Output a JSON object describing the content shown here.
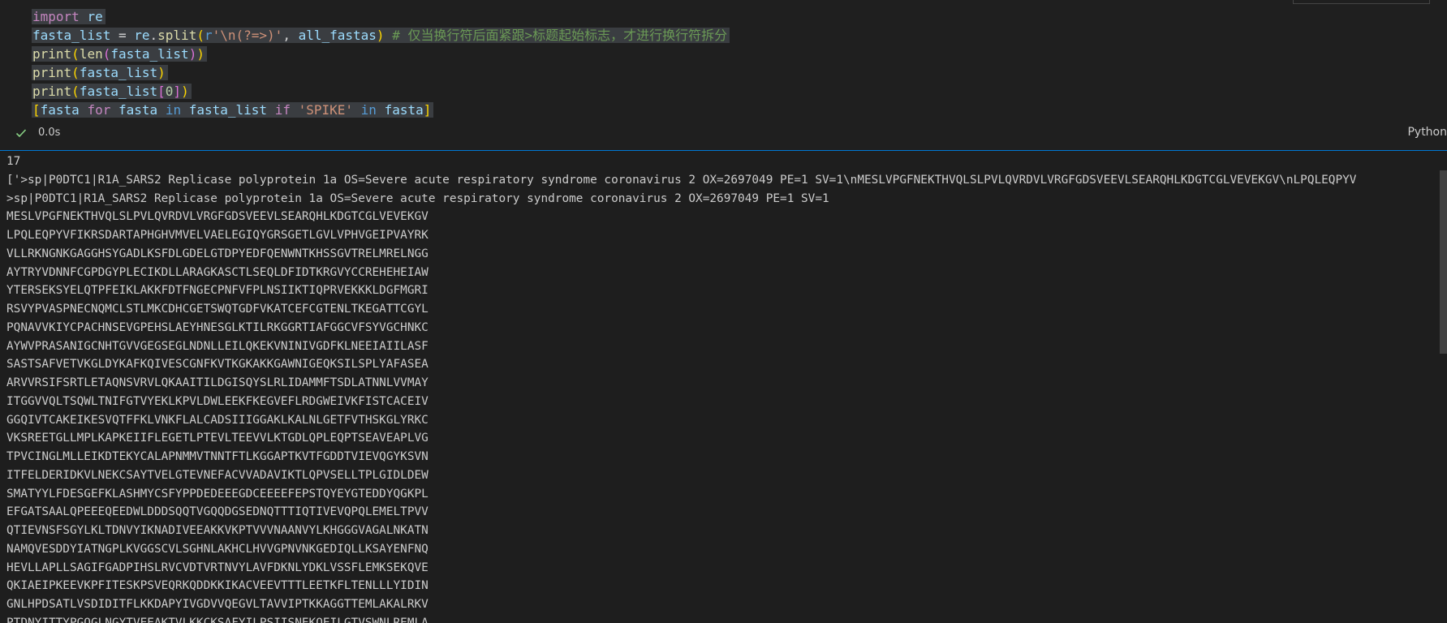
{
  "cell": {
    "code": {
      "line1": {
        "kw": "import",
        "mod": "re"
      },
      "line2": {
        "var": "fasta_list",
        "eq": "=",
        "obj": "re",
        "dot": ".",
        "fn": "split",
        "open": "(",
        "rprefix": "r",
        "pattern": "'\\n(?=>)'",
        "comma": ",",
        "arg": "all_fastas",
        "close": ")",
        "comment": "# 仅当换行符后面紧跟>标题起始标志，才进行换行符拆分"
      },
      "line3": {
        "fn1": "print",
        "o1": "(",
        "fn2": "len",
        "o2": "(",
        "arg": "fasta_list",
        "c2": ")",
        "c1": ")"
      },
      "line4": {
        "fn": "print",
        "open": "(",
        "arg": "fasta_list",
        "close": ")"
      },
      "line5": {
        "fn": "print",
        "open": "(",
        "arg": "fasta_list",
        "lb": "[",
        "idx": "0",
        "rb": "]",
        "close": ")"
      },
      "line6": {
        "lb": "[",
        "v1": "fasta",
        "for": "for",
        "v2": "fasta",
        "in1": "in",
        "v3": "fasta_list",
        "if": "if",
        "str": "'SPIKE'",
        "in2": "in",
        "v4": "fasta",
        "rb": "]"
      }
    },
    "exec_time": "0.0s",
    "language": "Python",
    "status_icon": "check-icon"
  },
  "output": {
    "lines": [
      "17",
      "['>sp|P0DTC1|R1A_SARS2 Replicase polyprotein 1a OS=Severe acute respiratory syndrome coronavirus 2 OX=2697049 PE=1 SV=1\\nMESLVPGFNEKTHVQLSLPVLQVRDVLVRGFGDSVEEVLSEARQHLKDGTCGLVEVEKGV\\nLPQLEQPYV",
      ">sp|P0DTC1|R1A_SARS2 Replicase polyprotein 1a OS=Severe acute respiratory syndrome coronavirus 2 OX=2697049 PE=1 SV=1",
      "MESLVPGFNEKTHVQLSLPVLQVRDVLVRGFGDSVEEVLSEARQHLKDGTCGLVEVEKGV",
      "LPQLEQPYVFIKRSDARTAPHGHVMVELVAELEGIQYGRSGETLGVLVPHVGEIPVAYRK",
      "VLLRKNGNKGAGGHSYGADLKSFDLGDELGTDPYEDFQENWNTKHSSGVTRELMRELNGG",
      "AYTRYVDNNFCGPDGYPLECIKDLLARAGKASCTLSEQLDFIDTKRGVYCCREHEHEIAW",
      "YTERSEKSYELQTPFEIKLAKKFDTFNGECPNFVFPLNSIIKTIQPRVEKKKLDGFMGRI",
      "RSVYPVASPNECNQMCLSTLMKCDHCGETSWQTGDFVKATCEFCGTENLTKEGATTCGYL",
      "PQNAVVKIYCPACHNSEVGPEHSLAEYHNESGLKTILRKGGRTIAFGGCVFSYVGCHNKC",
      "AYWVPRASANIGCNHTGVVGEGSEGLNDNLLEILQKEKVNINIVGDFKLNEEIAIILASF",
      "SASTSAFVETVKGLDYKAFKQIVESCGNFKVTKGKAKKGAWNIGEQKSILSPLYAFASEA",
      "ARVVRSIFSRTLETAQNSVRVLQKAAITILDGISQYSLRLIDAMMFTSDLATNNLVVMAY",
      "ITGGVVQLTSQWLTNIFGTVYEKLKPVLDWLEEKFKEGVEFLRDGWEIVKFISTCACEIV",
      "GGQIVTCAKEIKESVQTFFKLVNKFLALCADSIIIGGAKLKALNLGETFVTHSKGLYRKC",
      "VKSREETGLLMPLKAPKEIIFLEGETLPTEVLTEEVVLKTGDLQPLEQPTSEAVEAPLVG",
      "TPVCINGLMLLEIKDTEKYCALAPNMMVTNNTFTLKGGAPTKVTFGDDTVIEVQGYKSVN",
      "ITFELDERIDKVLNEKCSAYTVELGTEVNEFACVVADAVIKTLQPVSELLTPLGIDLDEW",
      "SMATYYLFDESGEFKLASHMYCSFYPPDEDEEEGDCEEEEFEPSTQYEYGTEDDYQGKPL",
      "EFGATSAALQPEEEQEEDWLDDDSQQTVGQQDGSEDNQTTTIQTIVEVQPQLEMELTPVV",
      "QTIEVNSFSGYLKLTDNVYIKNADIVEEAKKVKPTVVVNAANVYLKHGGGVAGALNKATN",
      "NAMQVESDDYIATNGPLKVGGSCVLSGHNLAKHCLHVVGPNVNKGEDIQLLKSAYENFNQ",
      "HEVLLAPLLSAGIFGADPIHSLRVCVDTVRTNVYLAVFDKNLYDKLVSSFLEMKSEKQVE",
      "QKIAEIPKEEVKPFITESKPSVEQRKQDDKKIKACVEEVTTTLEETKFLTENLLLYIDIN",
      "GNLHPDSATLVSDIDITFLKKDAPYIVGDVVQEGVLTAVVIPTKKAGGTTEMLAKALRKV",
      "PTDNYITTYPGQGLNGYTVEEAKTVLKKCKSAFYILPSIISNEKQEILGTVSWNLREMLA"
    ]
  }
}
